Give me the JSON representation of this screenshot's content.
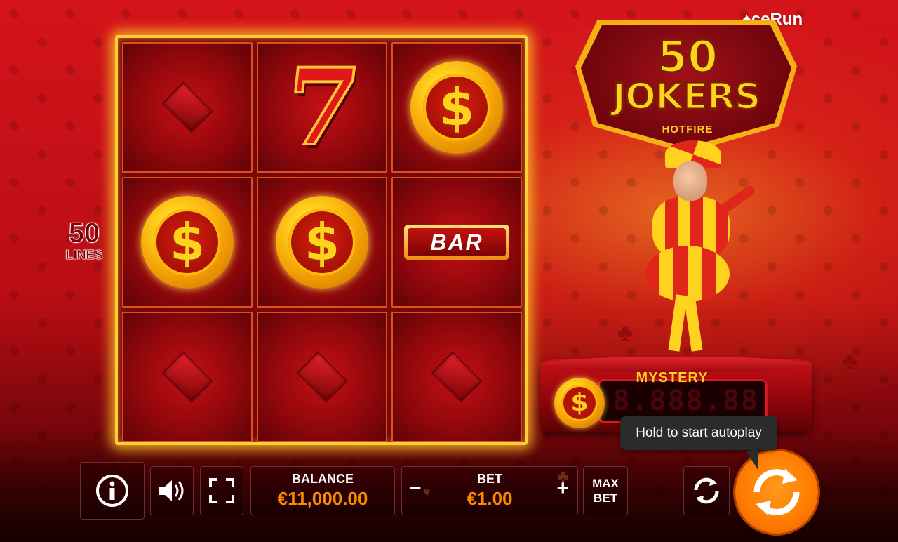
{
  "provider": "ceRun",
  "logo": {
    "top": "50",
    "main": "JOKERS",
    "sub": "HOTFIRE"
  },
  "lines": {
    "count": "50",
    "label": "LINES"
  },
  "reels": [
    [
      "diamond",
      "coin",
      "diamond"
    ],
    [
      "seven",
      "coin",
      "diamond"
    ],
    [
      "coin",
      "bar",
      "diamond"
    ]
  ],
  "symbols": {
    "coin_glyph": "$",
    "seven_glyph": "7",
    "bar_text": "BAR"
  },
  "mystery": {
    "label": "MYSTERY",
    "display": "8.888.88"
  },
  "tooltip": "Hold to start autoplay",
  "controls": {
    "balance_label": "BALANCE",
    "balance_value": "€11,000.00",
    "bet_label": "BET",
    "bet_value": "€1.00",
    "bet_minus": "−",
    "bet_plus": "+",
    "maxbet_line1": "MAX",
    "maxbet_line2": "BET"
  },
  "icons": [
    "info-icon",
    "speaker-icon",
    "fullscreen-icon",
    "autoplay-icon",
    "spin-icon"
  ],
  "colors": {
    "accent": "#ff8a00",
    "frame": "#ffcf3a",
    "background": "#c4111a"
  }
}
